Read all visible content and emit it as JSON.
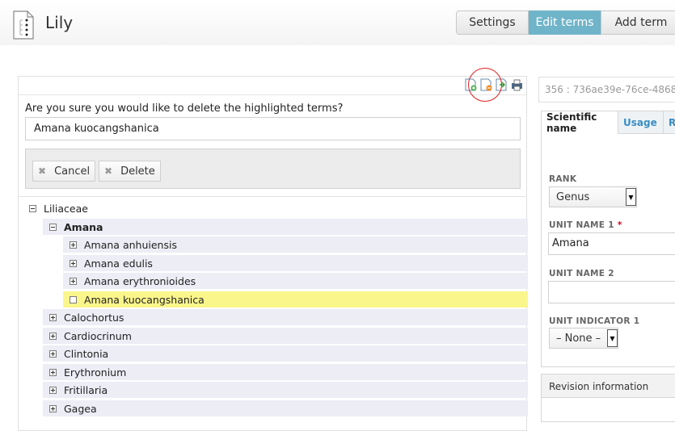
{
  "app": {
    "title": "Lily",
    "icon": "taxonomy-tree-icon"
  },
  "nav": {
    "settings_label": "Settings",
    "edit_terms_label": "Edit terms",
    "add_term_label": "Add term",
    "active_tab": "Edit terms",
    "active_color": "#6fb4c9"
  },
  "toolbar": {
    "icons": [
      "add-term-icon",
      "delete-term-icon",
      "move-term-icon",
      "print-icon"
    ],
    "highlighted_icon": "delete-term-icon",
    "highlight_color": "#e02020"
  },
  "confirm": {
    "question": "Are you sure you would like to delete the highlighted terms?",
    "term": "Amana kuocangshanica",
    "cancel_label": "Cancel",
    "delete_label": "Delete"
  },
  "tree": {
    "root": "Liliaceae",
    "genus": "Amana",
    "amana_children": [
      "Amana anhuiensis",
      "Amana edulis",
      "Amana erythronioides",
      "Amana kuocangshanica"
    ],
    "selected": "Amana kuocangshanica",
    "selected_color": "#fbf68c",
    "other_genera": [
      "Calochortus",
      "Cardiocrinum",
      "Clintonia",
      "Erythronium",
      "Fritillaria",
      "Gagea"
    ]
  },
  "detail": {
    "id_text": "356 : 736ae39e-76ce-4868",
    "tabs": [
      "Scientific name",
      "Usage",
      "R"
    ],
    "active_tab": "Scientific name",
    "rank_label": "RANK",
    "rank_value": "Genus",
    "unit_name1_label": "UNIT NAME 1",
    "unit_name1_required_mark": "*",
    "unit_name1_value": "Amana",
    "unit_name2_label": "UNIT NAME 2",
    "unit_name2_value": "",
    "unit_indicator1_label": "UNIT INDICATOR 1",
    "unit_indicator1_value": "– None –",
    "revision_title": "Revision information"
  }
}
